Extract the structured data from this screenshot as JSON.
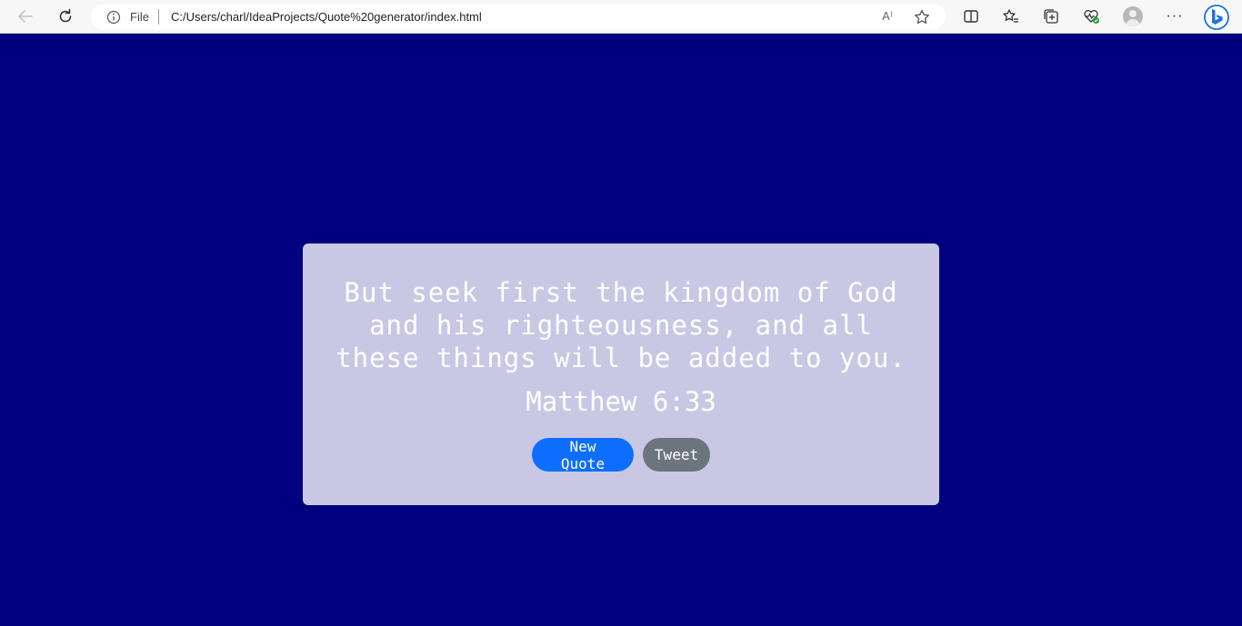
{
  "browser": {
    "address_prefix": "File",
    "url": "C:/Users/charl/IdeaProjects/Quote%20generator/index.html",
    "read_aloud_label": "A⁾",
    "more_label": "···"
  },
  "colors": {
    "page_background": "#000080",
    "card_background": "#c8c8e4",
    "new_quote_button": "#0d6efd",
    "tweet_button": "#6c757d"
  },
  "quote": {
    "text": "But seek first the kingdom of God and his righteousness, and all these things will be added to you.",
    "author": "Matthew 6:33"
  },
  "buttons": {
    "new_quote": "New Quote",
    "tweet": "Tweet"
  }
}
